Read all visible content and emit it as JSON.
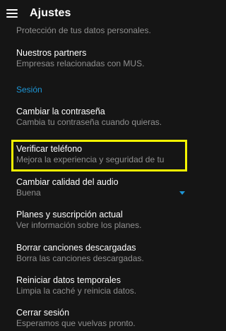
{
  "appbar": {
    "title": "Ajustes"
  },
  "items": {
    "privacy_sub": "Protección de tus datos personales.",
    "partners_title": "Nuestros partners",
    "partners_sub": "Empresas relacionadas con MUS.",
    "section_session": "Sesión",
    "password_title": "Cambiar la contraseña",
    "password_sub": "Cambia tu contraseña cuando quieras.",
    "verify_title": "Verificar teléfono",
    "verify_sub": "Mejora la experiencia y seguridad de tu",
    "audio_title": "Cambiar calidad del audio",
    "audio_value": "Buena",
    "plans_title": "Planes y suscripción actual",
    "plans_sub": "Ver información sobre los planes.",
    "delete_title": "Borrar canciones descargadas",
    "delete_sub": "Borra las canciones descargadas.",
    "restart_title": "Reiniciar datos temporales",
    "restart_sub": "Limpia la caché y reinicia datos.",
    "logout_title": "Cerrar sesión",
    "logout_sub": "Esperamos que vuelvas pronto."
  },
  "colors": {
    "accent": "#1e96d6",
    "highlight": "#f5f500",
    "background": "#151515"
  }
}
